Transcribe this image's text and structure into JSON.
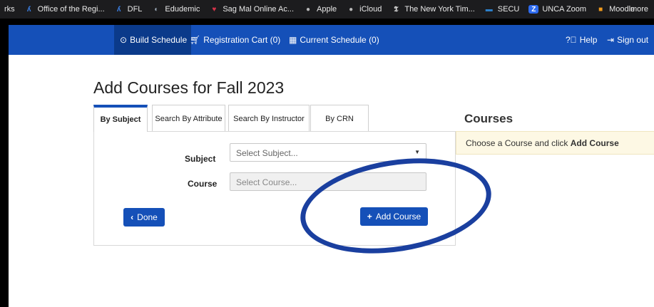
{
  "bookmarks": [
    {
      "label": "rks",
      "icon": "",
      "icon_color": ""
    },
    {
      "label": "Office of the Regi...",
      "icon": "uncw-icon",
      "icon_color": "#3c82e8"
    },
    {
      "label": "DFL",
      "icon": "uncw-icon",
      "icon_color": "#3c82e8"
    },
    {
      "label": "Edudemic",
      "icon": "edudemic-icon",
      "icon_color": "#9aa8b6"
    },
    {
      "label": "Sag Mal Online Ac...",
      "icon": "heart-icon",
      "icon_color": "#d6334a"
    },
    {
      "label": "Apple",
      "icon": "apple-icon",
      "icon_color": "#b8b8b8"
    },
    {
      "label": "iCloud",
      "icon": "apple-icon",
      "icon_color": "#b8b8b8"
    },
    {
      "label": "The New York Tim...",
      "icon": "nyt-icon",
      "icon_color": "#d6d6d6"
    },
    {
      "label": "SECU",
      "icon": "secu-icon",
      "icon_color": "#2c7fc8"
    },
    {
      "label": "UNCA Zoom",
      "icon": "zoom-icon",
      "icon_color": "#2e6bef"
    },
    {
      "label": "Moodle",
      "icon": "moodle-icon",
      "icon_color": "#f09a1c"
    }
  ],
  "bookmarks_more": "more",
  "nav": {
    "build_schedule": "Build Schedule",
    "registration_cart": "Registration Cart (0)",
    "current_schedule": "Current Schedule (0)",
    "help": "Help",
    "sign_out": "Sign out"
  },
  "page": {
    "title": "Add Courses for Fall 2023",
    "tabs": [
      "By Subject",
      "Search By Attribute",
      "Search By Instructor",
      "By CRN"
    ],
    "subject_label": "Subject",
    "subject_placeholder": "Select Subject...",
    "course_label": "Course",
    "course_placeholder": "Select Course...",
    "done_label": "Done",
    "add_course_label": "Add Course"
  },
  "courses": {
    "heading": "Courses",
    "notice_prefix": "Choose a Course and click ",
    "notice_bold": "Add Course"
  },
  "colors": {
    "nav_bg": "#1550b8",
    "nav_active": "#0b3a8a",
    "button": "#1550b8",
    "oval": "#1a3f9f",
    "notice_bg": "#fdf8e4"
  }
}
